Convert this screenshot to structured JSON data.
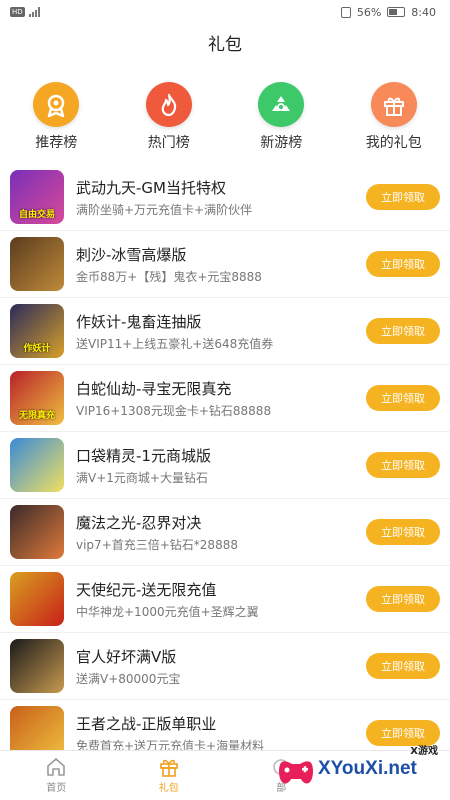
{
  "status_bar": {
    "hd_label": "HD",
    "battery": "56%",
    "time": "8:40"
  },
  "header": {
    "title": "礼包"
  },
  "categories": [
    {
      "label": "推荐榜",
      "icon": "recommend-icon",
      "color": "#f5a623"
    },
    {
      "label": "热门榜",
      "icon": "flame-icon",
      "color": "#f05a3c"
    },
    {
      "label": "新游榜",
      "icon": "recycle-icon",
      "color": "#3dc86a"
    },
    {
      "label": "我的礼包",
      "icon": "gift-box-icon",
      "color": "#f88a5a"
    }
  ],
  "gifts": [
    {
      "title": "武动九天-GM当托特权",
      "desc": "满阶坐骑+万元充值卡+满阶伙伴",
      "button": "立即领取",
      "icon_tag": "自由交易",
      "icon_colors": [
        "#7a2fb8",
        "#d84a9a"
      ]
    },
    {
      "title": "刺沙-冰雪高爆版",
      "desc": "金币88万+【残】鬼衣+元宝8888",
      "button": "立即领取",
      "icon_tag": "",
      "icon_colors": [
        "#5a3c1e",
        "#c08a3a"
      ]
    },
    {
      "title": "作妖计-鬼畜连抽版",
      "desc": "送VIP11+上线五豪礼+送648充值券",
      "button": "立即领取",
      "icon_tag": "作妖计",
      "icon_colors": [
        "#2a2a5a",
        "#d8a02a"
      ]
    },
    {
      "title": "白蛇仙劫-寻宝无限真充",
      "desc": "VIP16+1308元现金卡+钻石88888",
      "button": "立即领取",
      "icon_tag": "无限真充",
      "icon_colors": [
        "#b8202a",
        "#f0c040"
      ]
    },
    {
      "title": "口袋精灵-1元商城版",
      "desc": "满V+1元商城+大量钻石",
      "button": "立即领取",
      "icon_tag": "",
      "icon_colors": [
        "#3a8ad8",
        "#f0e060"
      ]
    },
    {
      "title": "魔法之光-忍界对决",
      "desc": "vip7+首充三倍+钻石*28888",
      "button": "立即领取",
      "icon_tag": "",
      "icon_colors": [
        "#3a2a2a",
        "#e07a3a"
      ]
    },
    {
      "title": "天使纪元-送无限充值",
      "desc": "中华神龙+1000元充值+圣辉之翼",
      "button": "立即领取",
      "icon_tag": "",
      "icon_colors": [
        "#d8a020",
        "#c8201a"
      ]
    },
    {
      "title": "官人好坏满V版",
      "desc": "送满V+80000元宝",
      "button": "立即领取",
      "icon_tag": "",
      "icon_colors": [
        "#1a1a1a",
        "#c89a50"
      ]
    },
    {
      "title": "王者之战-正版单职业",
      "desc": "免费首充+送万元充值卡+海量材料",
      "button": "立即领取",
      "icon_tag": "",
      "icon_colors": [
        "#c8601a",
        "#f0c040"
      ]
    }
  ],
  "tabs": [
    {
      "label": "首页",
      "icon": "home-icon",
      "active": false
    },
    {
      "label": "礼包",
      "icon": "gift-icon",
      "active": true
    },
    {
      "label": "部",
      "icon": "game-icon",
      "active": false
    },
    {
      "label": "",
      "icon": "",
      "active": false
    }
  ],
  "watermark": {
    "small": "X游戏",
    "text": "XYouXi.net"
  },
  "colors": {
    "accent": "#f6b321",
    "active_tab": "#f0a018"
  }
}
